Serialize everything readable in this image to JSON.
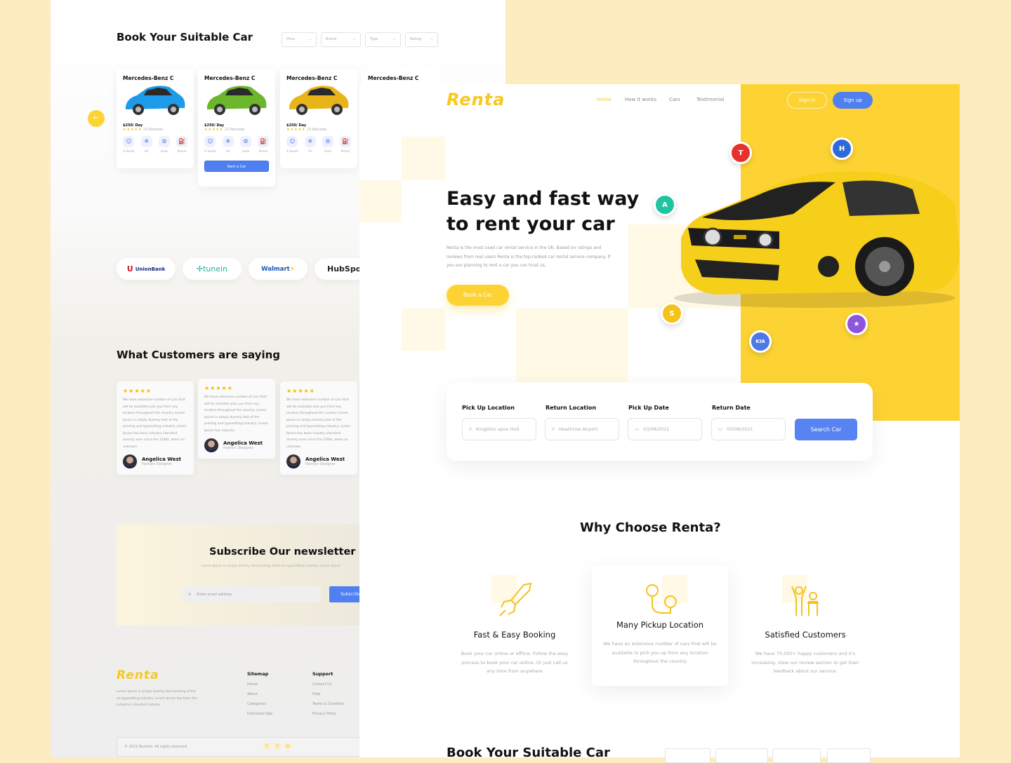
{
  "left_page": {
    "section_title": "Book Your Suitable Car",
    "filters": [
      "Price",
      "Brand",
      "Type",
      "Rating"
    ],
    "cars": [
      {
        "name": "Mercedes-Benz C",
        "price": "$250/ Day",
        "reviews": "23 Reviews",
        "color": "#1e9be8"
      },
      {
        "name": "Mercedes-Benz C",
        "price": "$250/ Day",
        "reviews": "23 Reviews",
        "color": "#6bb62a"
      },
      {
        "name": "Mercedes-Benz C",
        "price": "$250/ Day",
        "reviews": "23 Reviews",
        "color": "#e8b417"
      },
      {
        "name": "Mercedes-Benz C"
      }
    ],
    "features": [
      "4 Seats",
      "AC",
      "Auto",
      "Petrol"
    ],
    "rent_label": "Rent a Car",
    "rating": 5,
    "stars": "★★★★★",
    "partners": [
      "UnionBank",
      "tunein",
      "Walmart",
      "HubSpot"
    ],
    "testimonials_title": "What Customers are saying",
    "testimonials": [
      {
        "text": "We have extensive number of cars that will be available pick you from any location throughout the country. Lorem Ipsum is simply dummy text of the printing and typesetting industry. Lorem Ipsum has been industry standard dummy ever since the 1500s, when an unknown",
        "name": "Angelica West",
        "role": "Fashion Designer"
      },
      {
        "text": "We have extensive number of cars that will be available pick you from any location throughout the country. Lorem Ipsum is simply dummy text of the printing and typesetting industry. Lorem Ipsum has industry",
        "name": "Angelica West",
        "role": "Fashion Designer"
      },
      {
        "text": "We have extensive number of cars that will be available pick you from any location throughout the country. Lorem Ipsum is simply dummy text of the printing and typesetting industry. Lorem Ipsum has been industry standard dummy ever since the 1500s, when an unknown",
        "name": "Angelica West",
        "role": "Fashion Designer"
      }
    ],
    "newsletter": {
      "title": "Subscribe Our newsletter",
      "subtitle": "Lorem Ipsum is simply dummy text printing of  the an typesetting industry. Lorem Ipsum",
      "placeholder": "Enter email address",
      "button": "Subscribe"
    },
    "footer": {
      "logo": "Renta",
      "about": "Lorem Ipsum is simply dummy text printing of the an typesetting industry. Lorem Ipsum has been the industry's standard dummy.",
      "sitemap_title": "Sitemap",
      "sitemap": [
        "Home",
        "About",
        "Categories",
        "Download App"
      ],
      "support_title": "Support",
      "support": [
        "Contact Us",
        "Help",
        "Terms & Condition",
        "Privacy Policy"
      ],
      "copyright": "© 2021 Rummo. All rights reserved.",
      "social": [
        "f",
        "t",
        "ig"
      ]
    }
  },
  "right_page": {
    "logo": "Renta",
    "nav": [
      "Home",
      "How it works",
      "Cars",
      "Testimonial"
    ],
    "active_nav": "Home",
    "sign_in": "Sign in",
    "sign_up": "Sign up",
    "hero_title_1": "Easy and fast way",
    "hero_title_2": "to rent your car",
    "hero_text": "Renta is the most used car rental service in the UK. Based on ratings and reviews from real users Renta is the top-ranked car rental service company. If you are planning to rent a car you can trust us.",
    "hero_button": "Book a Car",
    "brands": [
      {
        "name": "toyota",
        "color": "#e5322d"
      },
      {
        "name": "hyundai",
        "color": "#2f6bd8"
      },
      {
        "name": "acura",
        "color": "#1fc4a3"
      },
      {
        "name": "suzuki",
        "color": "#f5c21a"
      },
      {
        "name": "kia",
        "color": "#4d78e8"
      },
      {
        "name": "mercedes",
        "color": "#8c55dd"
      }
    ],
    "search": {
      "pickup_label": "Pick Up Location",
      "pickup_value": "Kingston upon Hull",
      "return_label": "Return Location",
      "return_value": "Heathrow Airport",
      "pickup_date_label": "Pick Up Date",
      "pickup_date": "03/08/2021",
      "return_date_label": "Return Date",
      "return_date": "03/08/2021",
      "button": "Search Car"
    },
    "why_title": "Why Choose Renta?",
    "why": [
      {
        "title": "Fast & Easy Booking",
        "text": "Book your car online or offline. Follow the easy process to book your car online. Or just call us any time from anywhere",
        "icon": "rocket-icon"
      },
      {
        "title": "Many Pickup Location",
        "text": "We have an extensive number of cars that will be available to pick you up from any location throughout the country",
        "icon": "map-pin-icon"
      },
      {
        "title": "Satisfied Customers",
        "text": "We have 70,000+ happy customers and it's increasing. View our review section to get their feedback about our service.",
        "icon": "people-icon"
      }
    ],
    "book_title": "Book Your Suitable Car",
    "accent": "#fdd334",
    "primary": "#4f7ff0"
  }
}
